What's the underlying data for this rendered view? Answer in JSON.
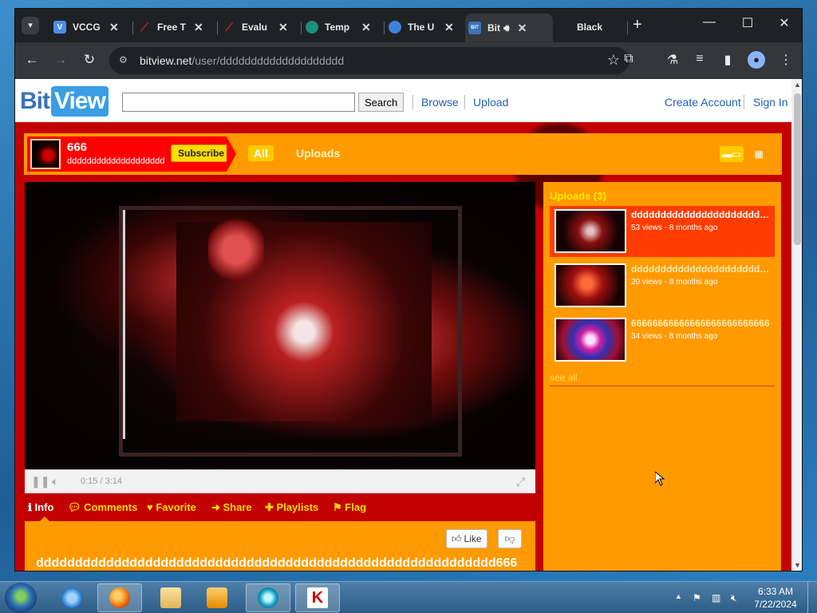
{
  "browser": {
    "tabs": [
      {
        "label": "VCCG",
        "favicon": "V",
        "color": "#4a8fe7"
      },
      {
        "label": "Free T",
        "favicon": "\\",
        "color": "#c41e3a"
      },
      {
        "label": "Evalu",
        "favicon": "\\",
        "color": "#c41e3a"
      },
      {
        "label": "Temp",
        "favicon": "◎",
        "color": "#1a8f7a"
      },
      {
        "label": "The U",
        "favicon": "◉",
        "color": "#3b82d6"
      },
      {
        "label": "Bit",
        "favicon": "BIT",
        "color": "#3a73b8",
        "active": true
      },
      {
        "label": "Black",
        "favicon": "",
        "color": "#202124"
      }
    ],
    "url_host": "bitview.net",
    "url_path": "/user/dddddddddddddddddddd"
  },
  "site": {
    "logo_bit": "Bit",
    "logo_view": "View",
    "search_placeholder": "",
    "search_button": "Search",
    "links": {
      "browse": "Browse",
      "upload": "Upload",
      "create_account": "Create Account",
      "sign_in": "Sign In"
    }
  },
  "channel": {
    "name": "666",
    "handle": "dddddddddddddddddddd",
    "subscribe_label": "Subscribe",
    "tab_all": "All",
    "tab_uploads": "Uploads",
    "colors": {
      "background": "#c20000",
      "bar": "#ff9a00",
      "accent": "#ffdd00"
    }
  },
  "player": {
    "time": "0:15 / 3:14",
    "progress": 0.08
  },
  "video_tabs": [
    {
      "label": "Info",
      "icon": "info-icon",
      "active": true
    },
    {
      "label": "Comments",
      "icon": "comment-icon"
    },
    {
      "label": "Favorite",
      "icon": "heart-icon"
    },
    {
      "label": "Share",
      "icon": "share-arrow-icon"
    },
    {
      "label": "Playlists",
      "icon": "plus-icon"
    },
    {
      "label": "Flag",
      "icon": "flag-icon"
    }
  ],
  "info": {
    "like_label": "Like",
    "title": "ddddddddddddddddddddddddddddddddddddddddddddddddddddddddddd666"
  },
  "uploads": {
    "header": "Uploads (3)",
    "items": [
      {
        "title": "dddddddddddddddddddddddddd",
        "meta": "53 views - 8 months ago",
        "active": true
      },
      {
        "title": "dddddddddddddddddddddddddd",
        "meta": "20 views - 8 months ago"
      },
      {
        "title": "66666666666666666666666666",
        "meta": "34 views - 8 months ago"
      }
    ],
    "see_all": "see all"
  },
  "taskbar": {
    "time": "6:33 AM",
    "date": "7/22/2024"
  }
}
